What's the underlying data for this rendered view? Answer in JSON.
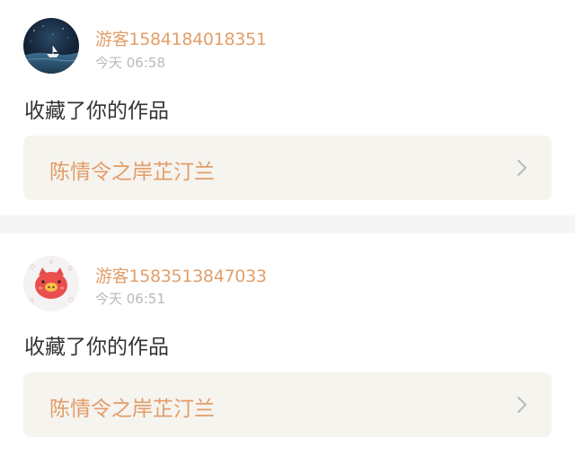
{
  "notifications": [
    {
      "username": "游客1584184018351",
      "time": "今天 06:58",
      "action": "收藏了你的作品",
      "work_title": "陈情令之岸芷汀兰",
      "avatar_icon": "night-sky-boat-avatar-icon"
    },
    {
      "username": "游客1583513847033",
      "time": "今天 06:51",
      "action": "收藏了你的作品",
      "work_title": "陈情令之岸芷汀兰",
      "avatar_icon": "red-pig-avatar-icon"
    }
  ],
  "colors": {
    "username": "#e29f6a",
    "work_title": "#e39c68",
    "time": "#b9b9b9",
    "action": "#333333",
    "link_bg": "#f5f4ef",
    "separator": "#f6f5f5"
  },
  "icons": {
    "chevron": "chevron-right-icon"
  }
}
